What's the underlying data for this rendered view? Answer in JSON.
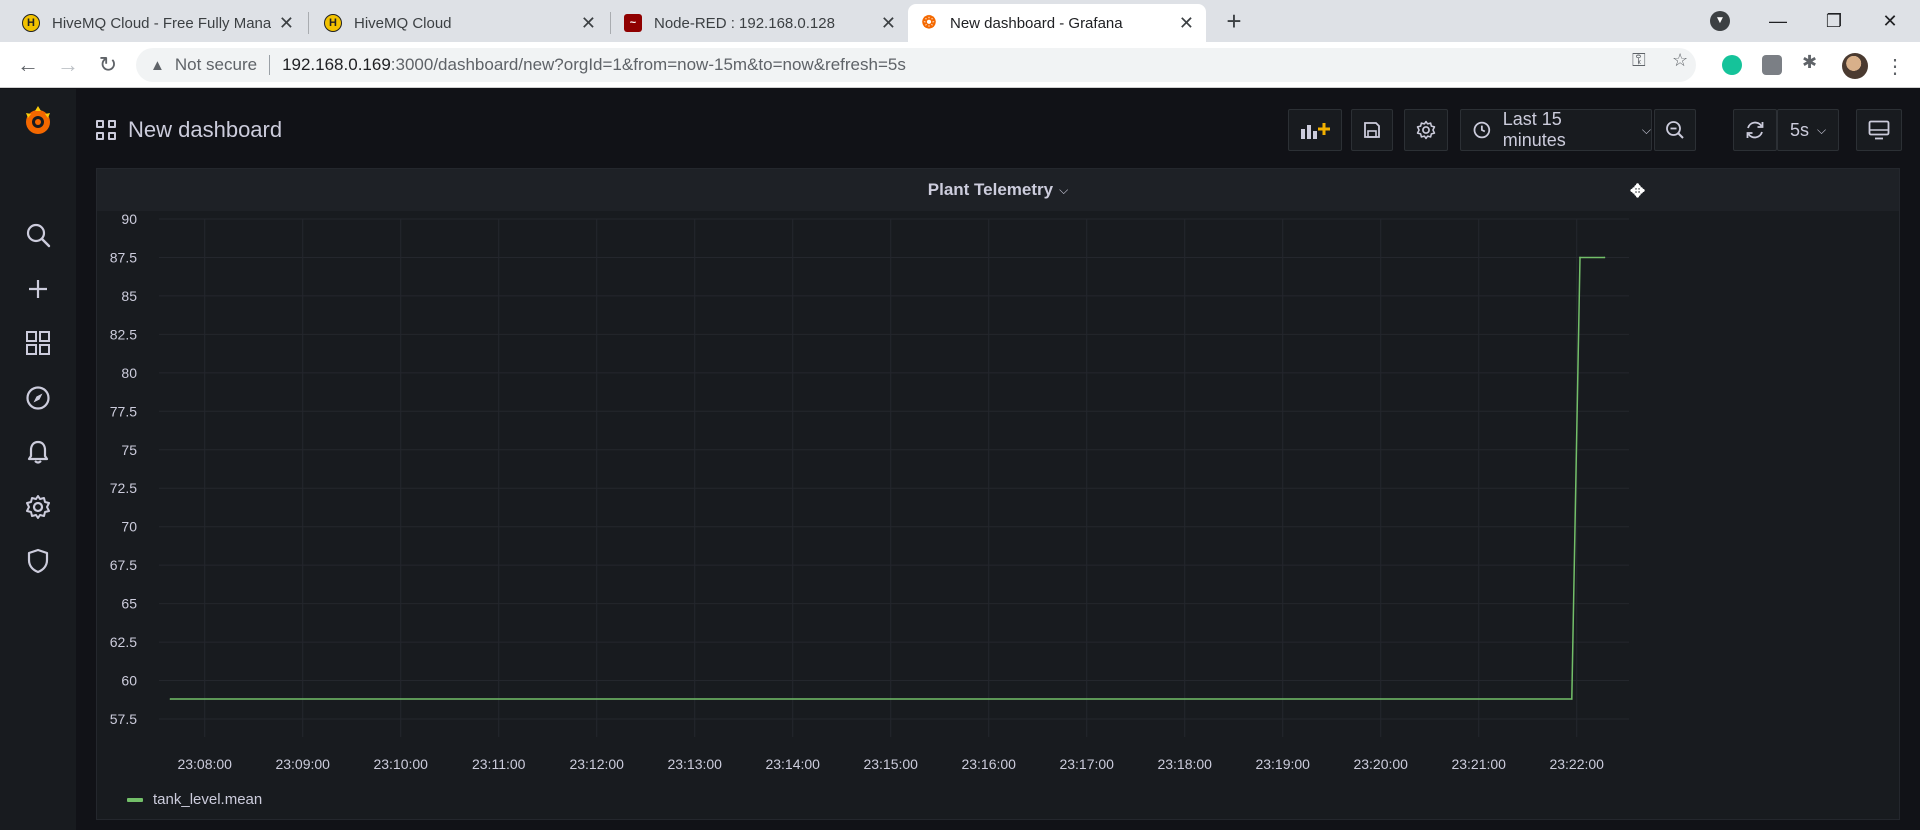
{
  "browser": {
    "tabs": [
      {
        "title": "HiveMQ Cloud - Free Fully Mana",
        "icon": "hivemq-icon"
      },
      {
        "title": "HiveMQ Cloud",
        "icon": "hivemq-icon"
      },
      {
        "title": "Node-RED : 192.168.0.128",
        "icon": "node-red-icon"
      },
      {
        "title": "New dashboard - Grafana",
        "icon": "grafana-icon",
        "active": true
      }
    ],
    "address": {
      "security_label": "Not secure",
      "url_host": "192.168.0.169",
      "url_rest": ":3000/dashboard/new?orgId=1&from=now-15m&to=now&refresh=5s"
    }
  },
  "grafana": {
    "dashboard_title": "New dashboard",
    "time_range_label": "Last 15 minutes",
    "refresh_label": "5s",
    "accent_color": "#f46800",
    "panel": {
      "title": "Plant Telemetry"
    }
  },
  "chart_data": {
    "type": "line",
    "title": "Plant Telemetry",
    "series": [
      {
        "name": "tank_level.mean",
        "color": "#73bf69",
        "points": [
          {
            "t": "23:07:39",
            "y": 58.8
          },
          {
            "t": "23:21:57",
            "y": 58.8
          },
          {
            "t": "23:22:02",
            "y": 87.5
          },
          {
            "t": "23:22:17",
            "y": 87.5
          }
        ]
      }
    ],
    "y_ticks": [
      "57.5",
      "60",
      "62.5",
      "65",
      "67.5",
      "70",
      "72.5",
      "75",
      "77.5",
      "80",
      "82.5",
      "85",
      "87.5",
      "90"
    ],
    "x_ticks": [
      "23:08:00",
      "23:09:00",
      "23:10:00",
      "23:11:00",
      "23:12:00",
      "23:13:00",
      "23:14:00",
      "23:15:00",
      "23:16:00",
      "23:17:00",
      "23:18:00",
      "23:19:00",
      "23:20:00",
      "23:21:00",
      "23:22:00"
    ],
    "ylim": [
      57.5,
      90
    ],
    "xlim": [
      "23:07:32",
      "23:22:32"
    ],
    "grid": true,
    "legend_position": "bottom-left"
  }
}
